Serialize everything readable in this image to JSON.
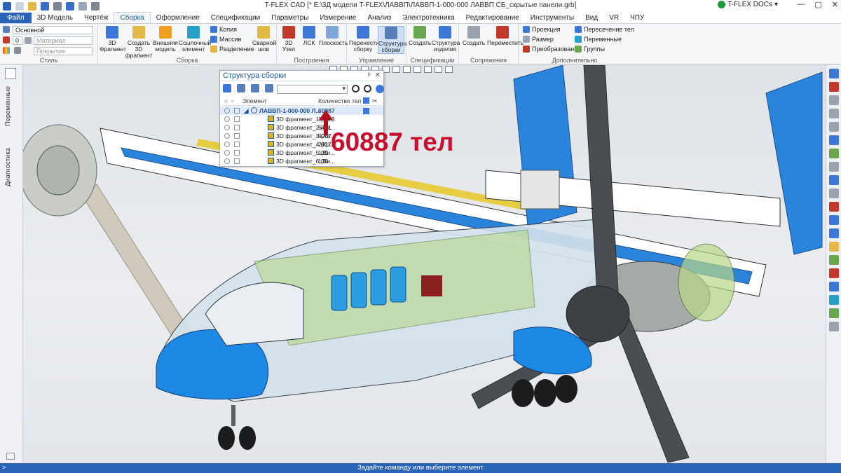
{
  "title_bar": {
    "title": "T-FLEX CAD [* E:\\3Д модели T-FLEX\\ЛАВВП\\ЛАВВП-1-000-000 ЛАВВП СБ_скрытые панели.grb]",
    "docs_label": "T-FLEX DOCs",
    "docs_menu": "▾",
    "minimize": "—",
    "maximize": "▢",
    "close": "✕"
  },
  "menu_tabs": [
    "Файл",
    "3D Модель",
    "Чертёж",
    "Сборка",
    "Оформление",
    "Спецификации",
    "Параметры",
    "Измерение",
    "Анализ",
    "Электротехника",
    "Редактирование",
    "Инструменты",
    "Вид",
    "VR",
    "ЧПУ"
  ],
  "active_tab": "Сборка",
  "ribbon": {
    "style": {
      "label": "Стиль",
      "layer": "Основной",
      "level": "0",
      "material": "Материал",
      "coating": "Покрытие"
    },
    "assembly": {
      "label": "Сборка",
      "buttons": [
        "3D Фрагмент",
        "Создать 3D фрагмент",
        "Внешняя модель",
        "Ссылочный элемент",
        "Сварной шов"
      ],
      "small": [
        "Копия",
        "Массив",
        "Разделение"
      ]
    },
    "construction": {
      "label": "Построения",
      "buttons": [
        "3D Узел",
        "ЛСК",
        "Плоскость"
      ]
    },
    "control": {
      "label": "Управление",
      "buttons": [
        "Перенести сборку",
        "Структура сборки"
      ]
    },
    "specs": {
      "label": "Спецификации",
      "buttons": [
        "Создать",
        "Структура изделия"
      ]
    },
    "mates": {
      "label": "Сопряжения",
      "buttons": [
        "Создать",
        "Переместить"
      ]
    },
    "extra": {
      "label": "Дополнительно",
      "left": [
        "Проекция",
        "Размер",
        "Преобразование"
      ],
      "right": [
        "Пересечение тел",
        "Переменные",
        "Группы"
      ]
    }
  },
  "left_tabs": [
    "Переменные",
    "Диагностика"
  ],
  "structure_panel": {
    "title": "Структура сборки",
    "pin": "ᵖ",
    "close": "✕",
    "col_element": "Элемент",
    "col_count": "Количество тел",
    "root": {
      "name": "ЛАВВП-1-000-000 Л...",
      "count": "60887"
    },
    "children": [
      {
        "name": "3D фрагмент_1 (Ф...",
        "count": "14723"
      },
      {
        "name": "3D фрагмент_2 (Ка...",
        "count": "6421"
      },
      {
        "name": "3D фрагмент_3 (Хв...",
        "count": "9257"
      },
      {
        "name": "3D фрагмент_4 (Кр...",
        "count": "28178"
      },
      {
        "name": "3D фрагмент_5 (Ви...",
        "count": "139"
      },
      {
        "name": "3D фрагмент_6 (Ви...",
        "count": "130"
      }
    ]
  },
  "annotation": "60887 тел",
  "status": {
    "text": "Задайте команду или выберите элемент",
    "prompt": ">"
  },
  "colors": {
    "accent": "#2b63b8",
    "annotation": "#c8102e",
    "model_blue": "#1e88e5",
    "frame_yellow": "#e6c619",
    "cabin_green": "#b5d98a",
    "blade_gray": "#4a4d52"
  }
}
